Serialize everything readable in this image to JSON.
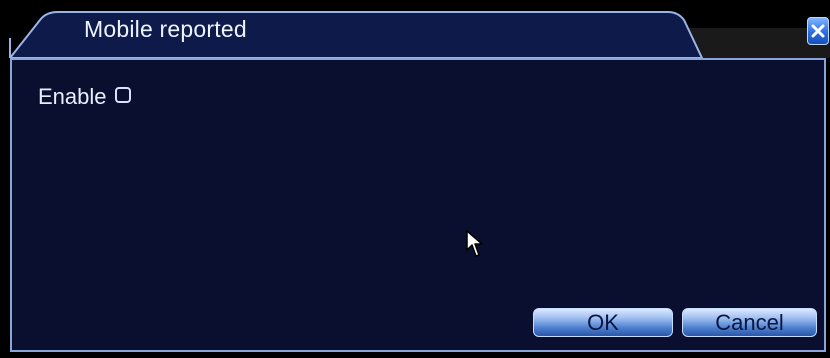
{
  "window": {
    "title": "Mobile reported",
    "close_icon": "close-icon"
  },
  "form": {
    "enable_label": "Enable",
    "enable_checked": false
  },
  "buttons": {
    "ok_label": "OK",
    "cancel_label": "Cancel"
  },
  "colors": {
    "panel_background": "#0a0f30",
    "tab_background": "#0d1a4a",
    "border": "#8aa6d8",
    "button_blue": "#4d7fcf",
    "close_blue": "#2a6fe0"
  },
  "icons": {
    "cursor": "mouse-pointer-icon"
  }
}
